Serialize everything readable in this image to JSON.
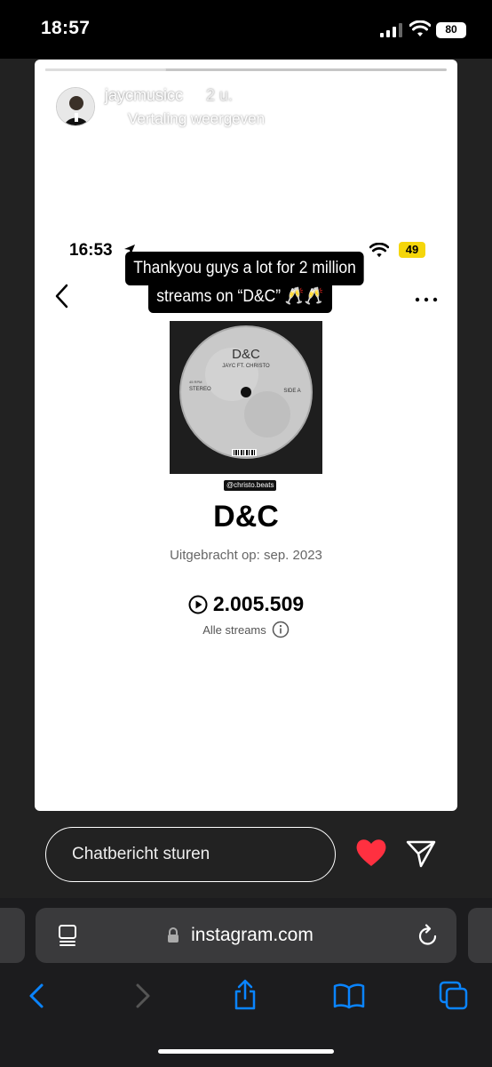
{
  "status_bar": {
    "time": "18:57",
    "battery": "80"
  },
  "story": {
    "progress": 0.3,
    "username": "jaycmusicc",
    "time_ago": "2 u.",
    "translate_label": "Vertaling weergeven",
    "icons": {
      "more": "more-horizontal-icon",
      "close": "close-icon"
    }
  },
  "inner_screen": {
    "time": "16:53",
    "battery": "49",
    "caption": {
      "line1": "Thankyou guys a lot for 2 million",
      "line2": "streams on “D&C” 🥂🥂"
    },
    "cover": {
      "title": "D&C",
      "artists": "JAYC FT. CHRISTO",
      "side": "SIDE A",
      "format": "STEREO",
      "rpm": "45 RPM",
      "credit": "@christo.beats"
    },
    "song_title": "D&C",
    "release_label": "Uitgebracht op: sep. 2023",
    "stream_count": "2.005.509",
    "all_streams_label": "Alle streams"
  },
  "reply": {
    "placeholder": "Chatbericht sturen",
    "accent": "#ff3040"
  },
  "browser": {
    "url": "instagram.com"
  }
}
